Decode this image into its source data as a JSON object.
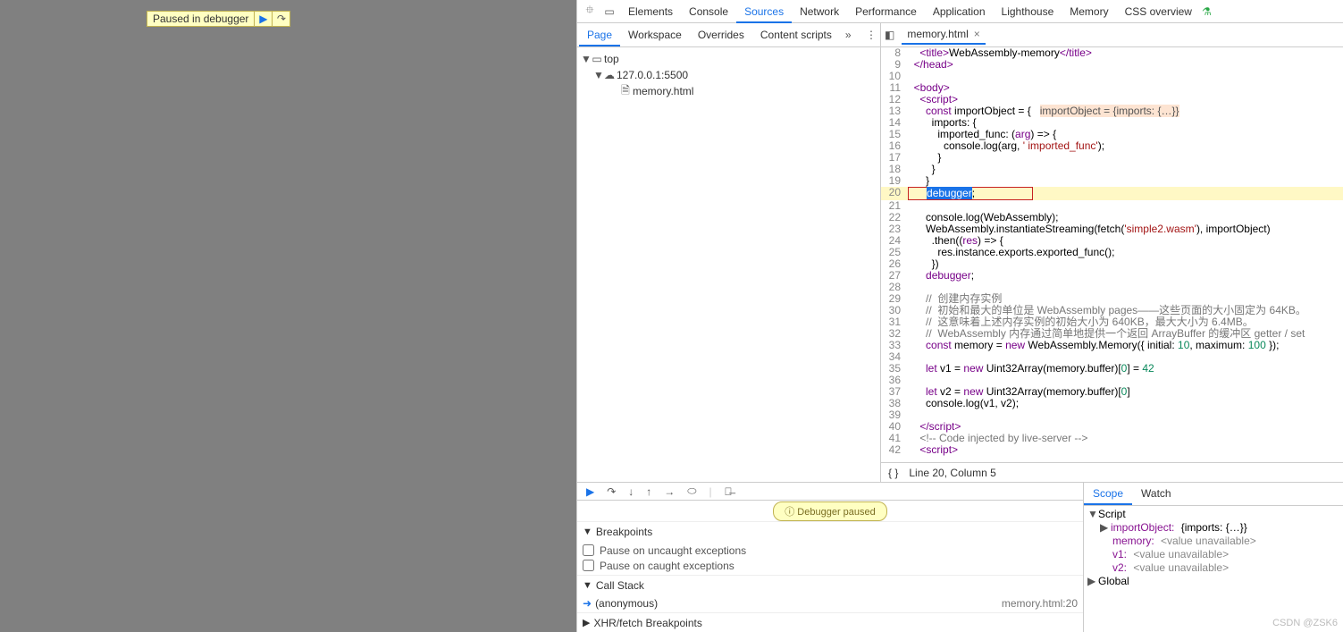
{
  "paused_pill": "Paused in debugger",
  "main_tabs": [
    "Elements",
    "Console",
    "Sources",
    "Network",
    "Performance",
    "Application",
    "Lighthouse",
    "Memory",
    "CSS overview"
  ],
  "main_active": 2,
  "sub_tabs": [
    "Page",
    "Workspace",
    "Overrides",
    "Content scripts"
  ],
  "sub_active": 0,
  "tree": {
    "top": "top",
    "origin": "127.0.0.1:5500",
    "file": "memory.html"
  },
  "open_file": "memory.html",
  "status": "Line 20, Column 5",
  "lines": [
    {
      "n": 8,
      "h": "    <span class='k'>&lt;title&gt;</span>WebAssembly-memory<span class='k'>&lt;/title&gt;</span>"
    },
    {
      "n": 9,
      "h": "  <span class='k'>&lt;/head&gt;</span>"
    },
    {
      "n": 10,
      "h": ""
    },
    {
      "n": 11,
      "h": "  <span class='k'>&lt;body&gt;</span>"
    },
    {
      "n": 12,
      "h": "    <span class='k'>&lt;script&gt;</span>"
    },
    {
      "n": 13,
      "h": "      <span class='k'>const</span> importObject = {   <span class='hint'>importObject = {imports: {…}}</span>"
    },
    {
      "n": 14,
      "h": "        imports: {"
    },
    {
      "n": 15,
      "h": "          imported_func: (<span class='k'>arg</span>) =&gt; {"
    },
    {
      "n": 16,
      "h": "            console.log(arg, <span class='s'>' imported_func'</span>);"
    },
    {
      "n": 17,
      "h": "          }"
    },
    {
      "n": 18,
      "h": "        }"
    },
    {
      "n": 19,
      "h": "      }"
    },
    {
      "n": 20,
      "hl": true,
      "h": "<span class='hl-box'>      <span class='sel'>debugger</span>;</span>"
    },
    {
      "n": 21,
      "h": ""
    },
    {
      "n": 22,
      "h": "      console.log(WebAssembly);"
    },
    {
      "n": 23,
      "h": "      WebAssembly.instantiateStreaming(fetch(<span class='s'>'simple2.wasm'</span>), importObject)"
    },
    {
      "n": 24,
      "h": "        .then((<span class='k'>res</span>) =&gt; {"
    },
    {
      "n": 25,
      "h": "          res.instance.exports.exported_func();"
    },
    {
      "n": 26,
      "h": "        })"
    },
    {
      "n": 27,
      "h": "      <span class='k'>debugger</span>;"
    },
    {
      "n": 28,
      "h": ""
    },
    {
      "n": 29,
      "h": "      <span class='c'>//  创建内存实例</span>"
    },
    {
      "n": 30,
      "h": "      <span class='c'>//  初始和最大的单位是 WebAssembly pages——这些页面的大小固定为 64KB。</span>"
    },
    {
      "n": 31,
      "h": "      <span class='c'>//  这意味着上述内存实例的初始大小为 640KB，最大大小为 6.4MB。</span>"
    },
    {
      "n": 32,
      "h": "      <span class='c'>//  WebAssembly 内存通过简单地提供一个返回 ArrayBuffer 的缓冲区 getter / set</span>"
    },
    {
      "n": 33,
      "h": "      <span class='k'>const</span> memory = <span class='k'>new</span> WebAssembly.Memory({ initial: <span class='n'>10</span>, maximum: <span class='n'>100</span> });"
    },
    {
      "n": 34,
      "h": ""
    },
    {
      "n": 35,
      "h": "      <span class='k'>let</span> v1 = <span class='k'>new</span> Uint32Array(memory.buffer)[<span class='n'>0</span>] = <span class='n'>42</span>"
    },
    {
      "n": 36,
      "h": ""
    },
    {
      "n": 37,
      "h": "      <span class='k'>let</span> v2 = <span class='k'>new</span> Uint32Array(memory.buffer)[<span class='n'>0</span>]"
    },
    {
      "n": 38,
      "h": "      console.log(v1, v2);"
    },
    {
      "n": 39,
      "h": ""
    },
    {
      "n": 40,
      "h": "    <span class='k'>&lt;/script&gt;</span>"
    },
    {
      "n": 41,
      "h": "    <span class='c'>&lt;!-- Code injected by live-server --&gt;</span>"
    },
    {
      "n": 42,
      "h": "    <span class='k'>&lt;script&gt;</span>"
    }
  ],
  "debugger_paused": "ⓘ Debugger paused",
  "bp_section": "Breakpoints",
  "bp_opts": [
    "Pause on uncaught exceptions",
    "Pause on caught exceptions"
  ],
  "callstack_section": "Call Stack",
  "stack": {
    "fn": "(anonymous)",
    "loc": "memory.html:20"
  },
  "xhr_section": "XHR/fetch Breakpoints",
  "scope_tabs": [
    "Scope",
    "Watch"
  ],
  "scope": {
    "script": "Script",
    "importObject": "importObject:",
    "importObjectVal": "{imports: {…}}",
    "memory": "memory:",
    "v1": "v1:",
    "v2": "v2:",
    "unavail": "<value unavailable>",
    "global": "Global"
  },
  "watermark": "CSDN @ZSK6"
}
